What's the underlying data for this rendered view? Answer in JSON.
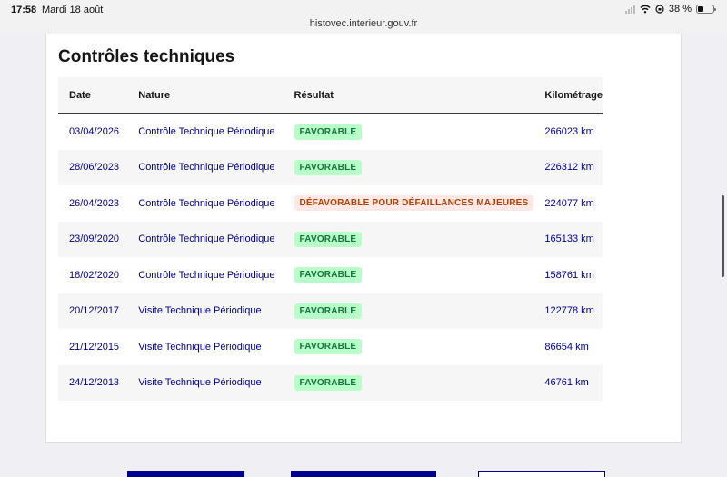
{
  "status_bar": {
    "time": "17:58",
    "date": "Mardi 18 août",
    "battery": "38 %",
    "battery_level_percent": 38
  },
  "browser": {
    "url": "histovec.interieur.gouv.fr"
  },
  "section": {
    "title": "Contrôles techniques"
  },
  "table": {
    "headers": [
      "Date",
      "Nature",
      "Résultat",
      "Kilométrage"
    ],
    "rows": [
      {
        "date": "03/04/2026",
        "nature": "Contrôle Technique Périodique",
        "result": "FAVORABLE",
        "status": "ok",
        "km": "266023 km"
      },
      {
        "date": "28/06/2023",
        "nature": "Contrôle Technique Périodique",
        "result": "FAVORABLE",
        "status": "ok",
        "km": "226312 km"
      },
      {
        "date": "26/04/2023",
        "nature": "Contrôle Technique Périodique",
        "result": "DÉFAVORABLE POUR DÉFAILLANCES MAJEURES",
        "status": "ko",
        "km": "224077 km"
      },
      {
        "date": "23/09/2020",
        "nature": "Contrôle Technique Périodique",
        "result": "FAVORABLE",
        "status": "ok",
        "km": "165133 km"
      },
      {
        "date": "18/02/2020",
        "nature": "Contrôle Technique Périodique",
        "result": "FAVORABLE",
        "status": "ok",
        "km": "158761 km"
      },
      {
        "date": "20/12/2017",
        "nature": "Visite Technique Périodique",
        "result": "FAVORABLE",
        "status": "ok",
        "km": "122778 km"
      },
      {
        "date": "21/12/2015",
        "nature": "Visite Technique Périodique",
        "result": "FAVORABLE",
        "status": "ok",
        "km": "86654 km"
      },
      {
        "date": "24/12/2013",
        "nature": "Visite Technique Périodique",
        "result": "FAVORABLE",
        "status": "ok",
        "km": "46761 km"
      }
    ]
  },
  "colors": {
    "link_blue": "#000091",
    "favorable_bg": "#b8fec9",
    "favorable_text": "#18753c",
    "defavorable_bg": "#ffe9e6",
    "defavorable_text": "#b34000"
  },
  "icons": [
    "wifi-icon",
    "signal-icon",
    "orientation-lock-icon",
    "battery-icon"
  ]
}
